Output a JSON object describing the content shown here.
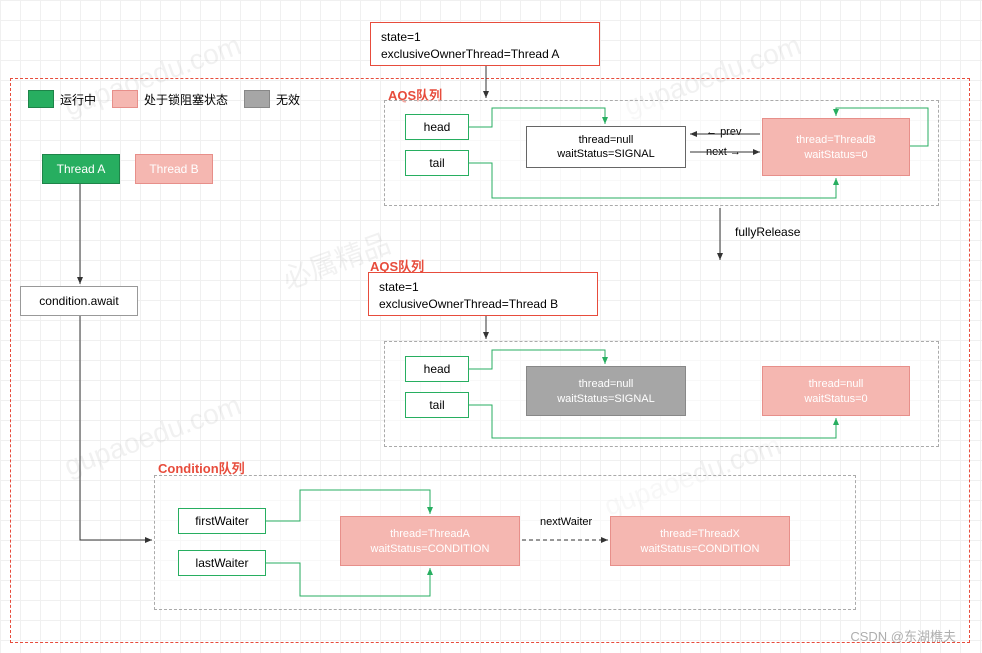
{
  "legend": {
    "running": "运行中",
    "blocked": "处于锁阻塞状态",
    "invalid": "无效"
  },
  "threads": {
    "a": "Thread A",
    "b": "Thread B"
  },
  "condition_await": "condition.await",
  "state1": {
    "line1": "state=1",
    "line2": "exclusiveOwnerThread=Thread A"
  },
  "aqs1": {
    "label": "AQS队列",
    "head": "head",
    "tail": "tail",
    "node1": {
      "l1": "thread=null",
      "l2": "waitStatus=SIGNAL"
    },
    "node2": {
      "l1": "thread=ThreadB",
      "l2": "waitStatus=0"
    },
    "prev": "prev",
    "next": "next"
  },
  "fullyRelease": "fullyRelease",
  "aqs2_label": "AQS队列",
  "state2": {
    "line1": "state=1",
    "line2": "exclusiveOwnerThread=Thread B"
  },
  "aqs2": {
    "head": "head",
    "tail": "tail",
    "node1": {
      "l1": "thread=null",
      "l2": "waitStatus=SIGNAL"
    },
    "node2": {
      "l1": "thread=null",
      "l2": "waitStatus=0"
    }
  },
  "cond": {
    "label": "Condition队列",
    "first": "firstWaiter",
    "last": "lastWaiter",
    "n1": {
      "l1": "thread=ThreadA",
      "l2": "waitStatus=CONDITION"
    },
    "n2": {
      "l1": "thread=ThreadX",
      "l2": "waitStatus=CONDITION"
    },
    "nextWaiter": "nextWaiter"
  },
  "watermark": "CSDN @东湖樵夫"
}
